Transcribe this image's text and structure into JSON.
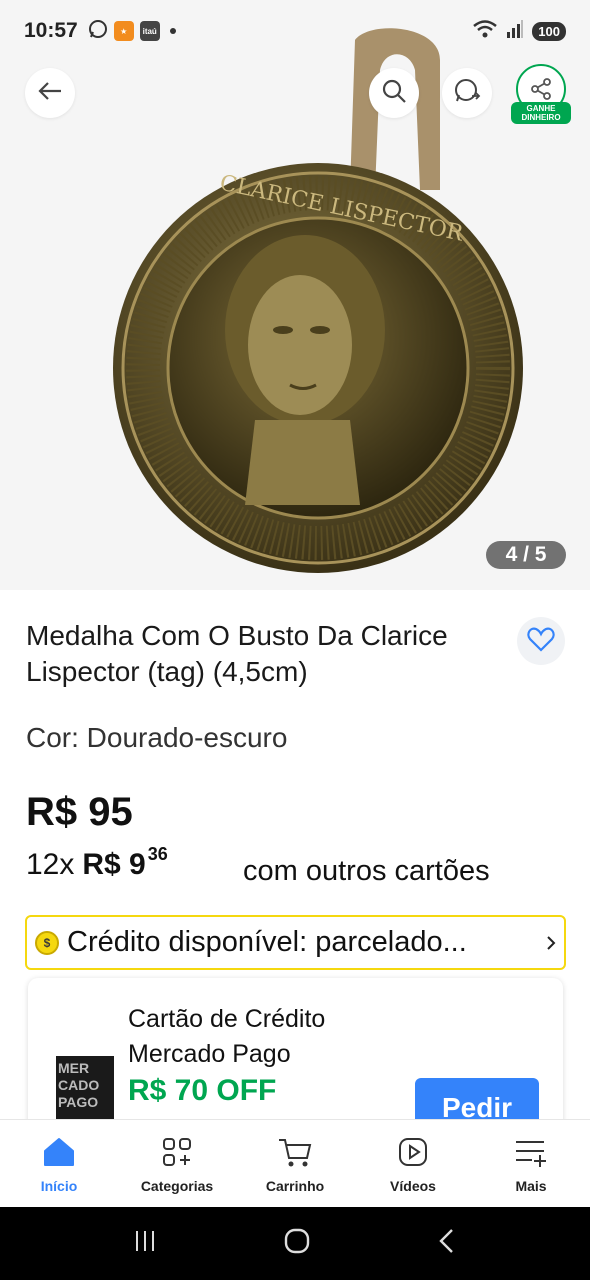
{
  "status_bar": {
    "time": "10:57",
    "bank_label": "itaú",
    "battery": "100"
  },
  "hero": {
    "image_description_icon": "medal-image",
    "earn_label_line1": "GANHE",
    "earn_label_line2": "DINHEIRO",
    "counter": "4 / 5",
    "medal_text": "CLARICE LISPECTOR"
  },
  "product": {
    "title": "Medalha Com O Busto Da Clarice Lispector (tag) (4,5cm)",
    "variant": "Cor: Dourado-escuro",
    "price": "R$ 95",
    "installment_count": "12x",
    "installment_price": "R$ 9",
    "installment_cents": "36",
    "installment_extra": "com outros cartões"
  },
  "credit": {
    "text": "Crédito disponível: parcelado..."
  },
  "card_offer": {
    "thumb_text": "MER CADO PAGO",
    "title": "Cartão de Crédito Mercado Pago",
    "offer": "R$ 70 OFF",
    "button": "Pedir"
  },
  "bottom_nav": {
    "items": [
      {
        "label": "Início",
        "icon": "home-icon"
      },
      {
        "label": "Categorias",
        "icon": "categories-icon"
      },
      {
        "label": "Carrinho",
        "icon": "cart-icon"
      },
      {
        "label": "Vídeos",
        "icon": "video-icon"
      },
      {
        "label": "Mais",
        "icon": "more-icon"
      }
    ]
  },
  "colors": {
    "accent_blue": "#3483fa",
    "green": "#00a650",
    "yellow": "#f5d80f"
  }
}
